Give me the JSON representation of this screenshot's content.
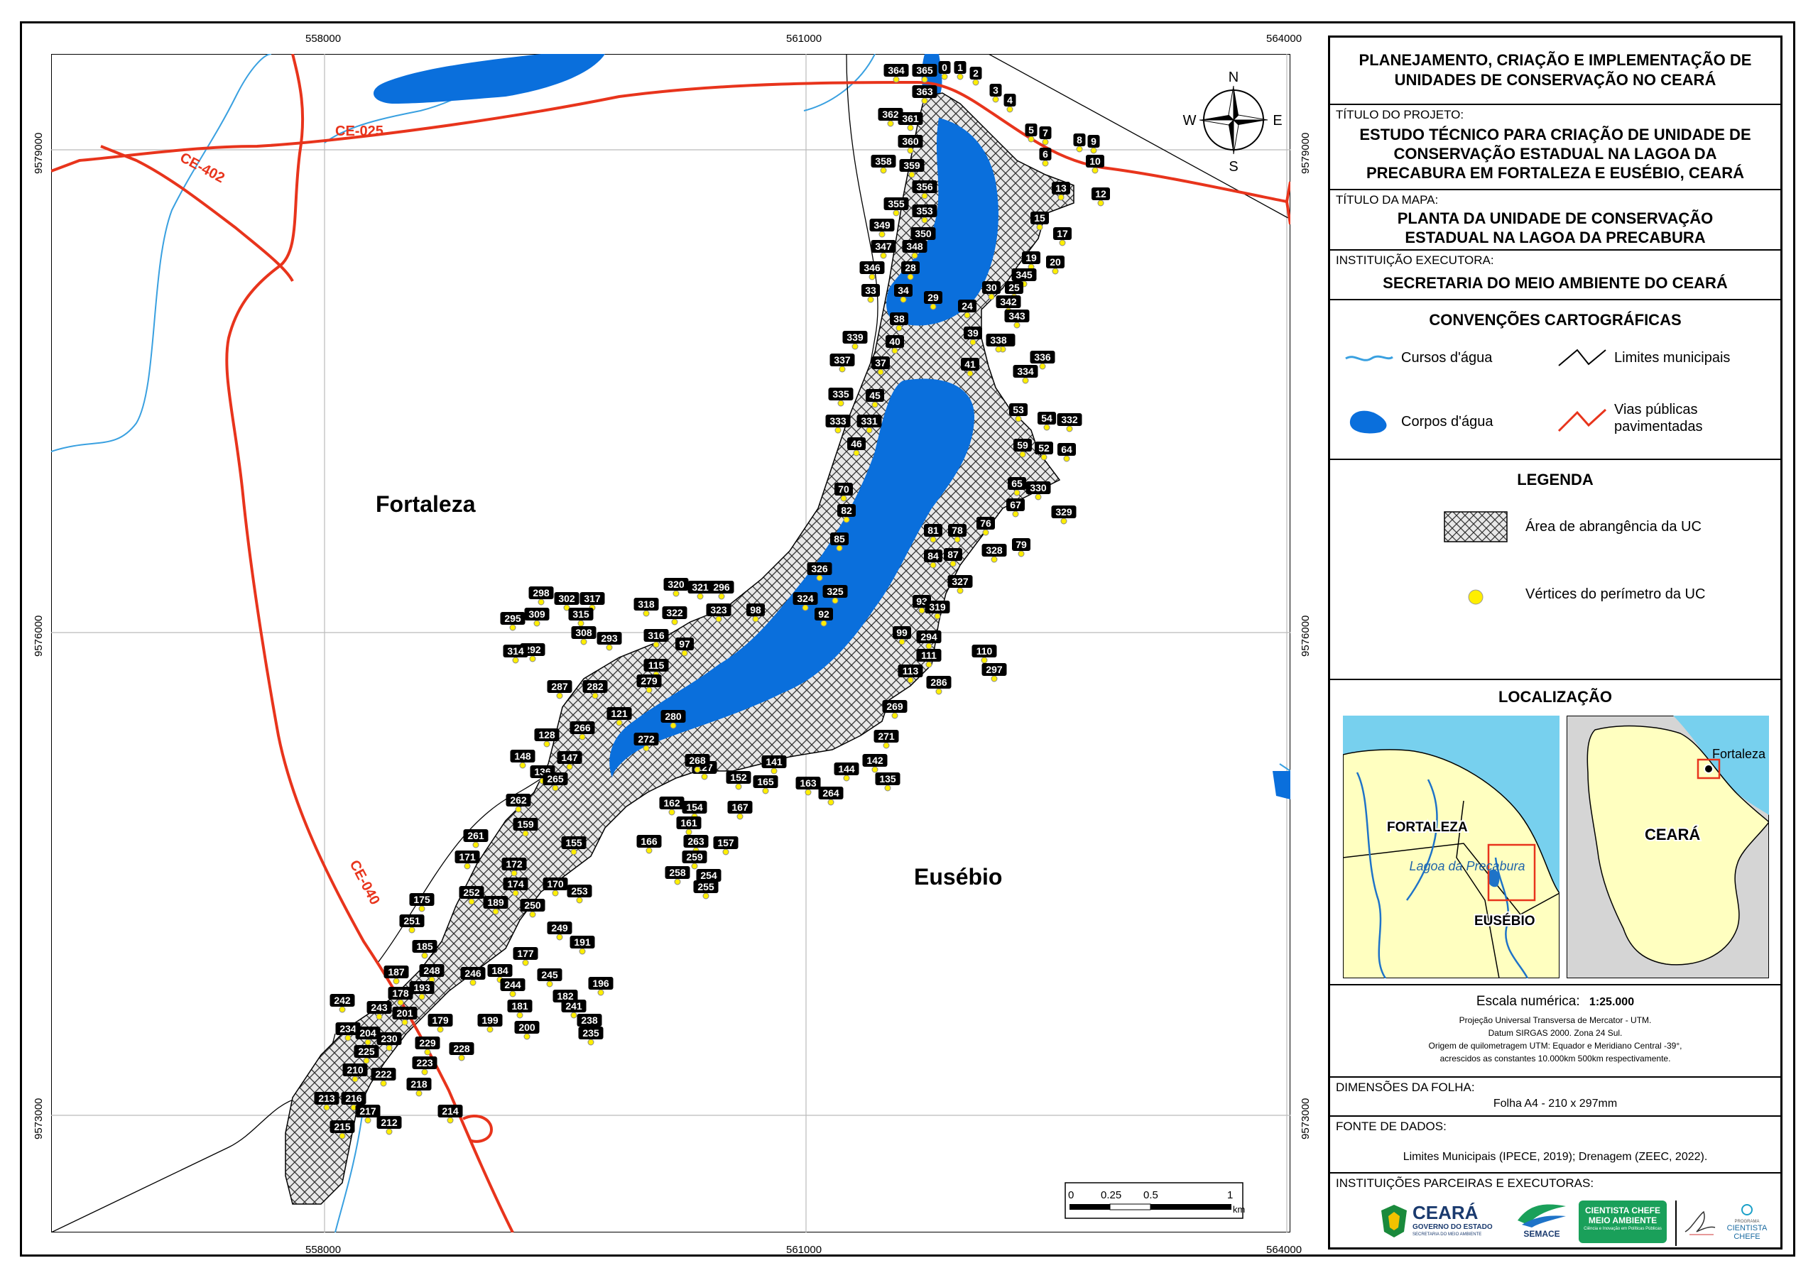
{
  "header": {
    "main_title": "PLANEJAMENTO, CRIAÇÃO E IMPLEMENTAÇÃO DE UNIDADES DE CONSERVAÇÃO NO CEARÁ",
    "project_label": "TÍTULO DO PROJETO:",
    "project_title": "ESTUDO TÉCNICO PARA CRIAÇÃO DE UNIDADE DE CONSERVAÇÃO ESTADUAL NA LAGOA DA PRECABURA EM FORTALEZA E EUSÉBIO, CEARÁ",
    "map_label": "TÍTULO DA MAPA:",
    "map_title": "PLANTA DA UNIDADE DE CONSERVAÇÃO ESTADUAL NA LAGOA DA PRECABURA",
    "institution_label": "INSTITUIÇÃO EXECUTORA:",
    "institution": "SECRETARIA DO MEIO AMBIENTE DO CEARÁ"
  },
  "conventions": {
    "title": "CONVENÇÕES CARTOGRÁFICAS",
    "items": [
      "Cursos d'água",
      "Limites municipais",
      "Corpos d'água",
      "Vias públicas pavimentadas"
    ]
  },
  "legend": {
    "title": "LEGENDA",
    "area": "Área de abrangência da UC",
    "vertices": "Vértices do perímetro da UC"
  },
  "location": {
    "title": "LOCALIZAÇÃO",
    "inset_labels": [
      "FORTALEZA",
      "Lagoa da Precabura",
      "EUSÉBIO",
      "CEARÁ",
      "Fortaleza"
    ]
  },
  "scale": {
    "label": "Escala numérica:",
    "value": "1:25.000",
    "notes": [
      "Projeção Universal Transversa de Mercator - UTM.",
      "Datum SIRGAS 2000. Zona 24 Sul.",
      "Origem de quilometragem UTM: Equador e Meridiano Central -39°,",
      "acrescidos as constantes 10.000km 500km respectivamente."
    ],
    "bar_labels": [
      "0",
      "0.25",
      "0.5",
      "1"
    ],
    "bar_unit": "km"
  },
  "sheet": {
    "label": "DIMENSÕES DA FOLHA:",
    "value": "Folha A4 - 210 x 297mm"
  },
  "sources": {
    "label": "FONTE DE DADOS:",
    "value": "Limites Municipais (IPECE, 2019); Drenagem (ZEEC, 2022)."
  },
  "partners": {
    "label": "INSTITUIÇÕES PARCEIRAS E EXECUTORAS:",
    "ceara_name": "CEARÁ",
    "ceara_sub": "GOVERNO DO ESTADO",
    "ceara_sub2": "SECRETARIA DO MEIO AMBIENTE",
    "semace": "SEMACE",
    "cientista_box_1": "CIENTISTA CHEFE",
    "cientista_box_2": "MEIO AMBIENTE",
    "cientista_box_3": "Ciência e Inovação em Políticas Públicas",
    "programa_1": "PROGRAMA",
    "programa_2": "CIENTISTA",
    "programa_3": "CHEFE"
  },
  "map": {
    "coords_top": [
      "558000",
      "561000",
      "564000"
    ],
    "coords_bottom": [
      "558000",
      "561000",
      "564000"
    ],
    "coords_left": [
      "9579000",
      "9576000",
      "9573000"
    ],
    "coords_right": [
      "9579000",
      "9576000",
      "9573000"
    ],
    "roads": [
      "CE-025",
      "CE-402",
      "CE-040"
    ],
    "municipalities": [
      "Fortaleza",
      "Eusébio"
    ],
    "compass": [
      "N",
      "S",
      "E",
      "W"
    ],
    "vertex_labels": [
      "364",
      "365",
      "0",
      "1",
      "2",
      "363",
      "3",
      "4",
      "362",
      "361",
      "360",
      "5",
      "7",
      "8",
      "9",
      "6",
      "10",
      "358",
      "359",
      "356",
      "13",
      "12",
      "355",
      "353",
      "15",
      "349",
      "350",
      "17",
      "347",
      "348",
      "19",
      "20",
      "345",
      "346",
      "28",
      "30",
      "25",
      "342",
      "343",
      "33",
      "34",
      "29",
      "24",
      "341",
      "38",
      "39",
      "338",
      "339",
      "40",
      "336",
      "337",
      "37",
      "41",
      "334",
      "335",
      "45",
      "53",
      "54",
      "332",
      "333",
      "331",
      "46",
      "59",
      "52",
      "64",
      "65",
      "330",
      "70",
      "67",
      "329",
      "82",
      "81",
      "78",
      "76",
      "79",
      "328",
      "85",
      "84",
      "87",
      "327",
      "326",
      "325",
      "324",
      "92",
      "93",
      "319",
      "320",
      "321",
      "296",
      "298",
      "302",
      "317",
      "318",
      "322",
      "323",
      "98",
      "99",
      "294",
      "295",
      "309",
      "315",
      "316",
      "97",
      "111",
      "110",
      "297",
      "308",
      "293",
      "292",
      "314",
      "115",
      "113",
      "286",
      "287",
      "282",
      "279",
      "121",
      "280",
      "269",
      "272",
      "128",
      "266",
      "271",
      "148",
      "147",
      "142",
      "136",
      "127",
      "268",
      "141",
      "144",
      "135",
      "265",
      "163",
      "152",
      "165",
      "264",
      "262",
      "162",
      "154",
      "167",
      "161",
      "159",
      "261",
      "263",
      "157",
      "155",
      "166",
      "259",
      "171",
      "172",
      "258",
      "254",
      "255",
      "170",
      "253",
      "174",
      "175",
      "252",
      "189",
      "250",
      "251",
      "249",
      "191",
      "185",
      "177",
      "248",
      "246",
      "184",
      "187",
      "244",
      "245",
      "196",
      "193",
      "178",
      "182",
      "181",
      "242",
      "243",
      "201",
      "179",
      "199",
      "241",
      "238",
      "200",
      "235",
      "234",
      "204",
      "230",
      "229",
      "228",
      "225",
      "223",
      "210",
      "222",
      "218",
      "213",
      "216",
      "217",
      "212",
      "214",
      "215"
    ]
  }
}
